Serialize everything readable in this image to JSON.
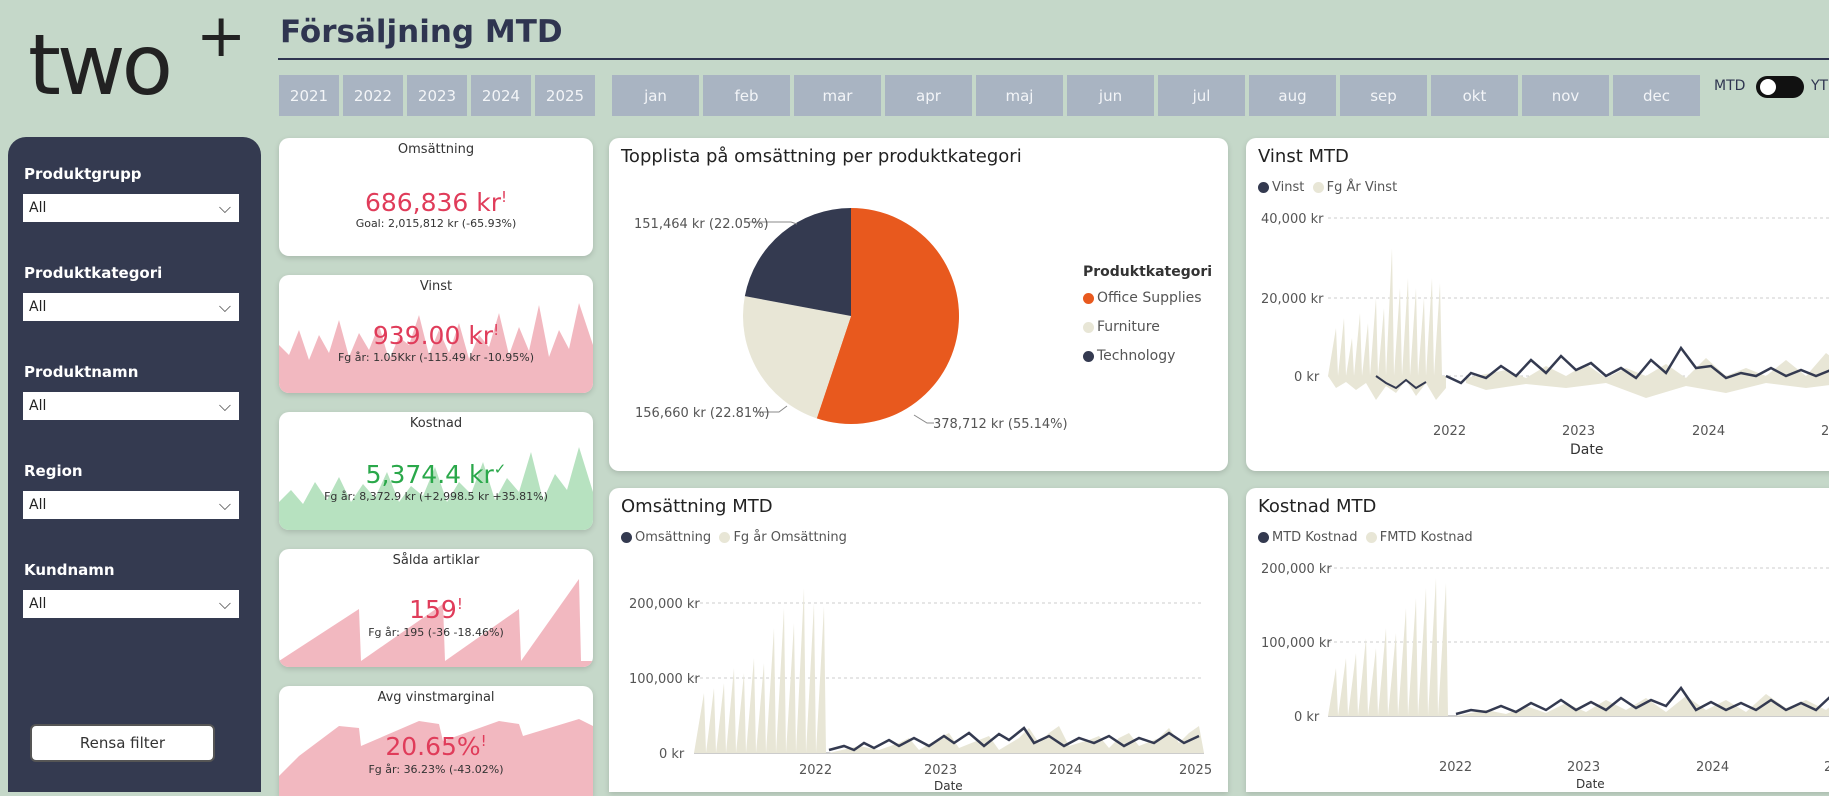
{
  "brand": {
    "logo_text": "two",
    "logo_plus": "+"
  },
  "page_title": "Försäljning MTD",
  "years": [
    "2021",
    "2022",
    "2023",
    "2024",
    "2025"
  ],
  "months": [
    "jan",
    "feb",
    "mar",
    "apr",
    "maj",
    "jun",
    "jul",
    "aug",
    "sep",
    "okt",
    "nov",
    "dec"
  ],
  "toggle": {
    "left": "MTD",
    "right": "YT"
  },
  "filters": [
    {
      "label": "Produktgrupp",
      "value": "All"
    },
    {
      "label": "Produktkategori",
      "value": "All"
    },
    {
      "label": "Produktnamn",
      "value": "All"
    },
    {
      "label": "Region",
      "value": "All"
    },
    {
      "label": "Kundnamn",
      "value": "All"
    }
  ],
  "clear_filter": "Rensa filter",
  "kpis": [
    {
      "title": "Omsättning",
      "value": "686,836 kr",
      "mark": "!",
      "sub": "Goal: 2,015,812 kr (-65.93%)"
    },
    {
      "title": "Vinst",
      "value": "939.00 kr",
      "mark": "!",
      "sub": "Fg år: 1.05Kkr (-115.49 kr -10.95%)"
    },
    {
      "title": "Kostnad",
      "value": "5,374.4 kr",
      "mark": "✓",
      "sub": "Fg år: 8,372.9 kr (+2,998.5 kr +35.81%)"
    },
    {
      "title": "Sålda artiklar",
      "value": "159",
      "mark": "!",
      "sub": "Fg år: 195 (-36 -18.46%)"
    },
    {
      "title": "Avg vinstmarginal",
      "value": "20.65%",
      "mark": "!",
      "sub": "Fg år: 36.23% (-43.02%)"
    }
  ],
  "colors": {
    "bg": "#c5d8c9",
    "navy": "#343a50",
    "orange": "#e8591e",
    "beige": "#e8e6d6",
    "red": "#e03c5a",
    "green": "#2aa84a",
    "pink": "#f2b8c0",
    "lightgreen": "#b7e2c0"
  },
  "pie": {
    "title": "Topplista på omsättning per produktkategori",
    "legend_title": "Produktkategori",
    "chart_data": {
      "type": "pie",
      "slices": [
        {
          "name": "Office Supplies",
          "value": 378712,
          "label": "378,712 kr (55.14%)",
          "color": "#e8591e"
        },
        {
          "name": "Furniture",
          "value": 156660,
          "label": "156,660 kr (22.81%)",
          "color": "#e8e6d6"
        },
        {
          "name": "Technology",
          "value": 151464,
          "label": "151,464 kr (22.05%)",
          "color": "#343a50"
        }
      ]
    }
  },
  "vinst_chart": {
    "title": "Vinst MTD",
    "legend": [
      "Vinst",
      "Fg År Vinst"
    ],
    "yticks": [
      "40,000 kr",
      "20,000 kr",
      "0 kr"
    ],
    "xticks": [
      "2022",
      "2023",
      "2024",
      "2"
    ],
    "xlabel": "Date"
  },
  "oms_chart": {
    "title": "Omsättning MTD",
    "legend": [
      "Omsättning",
      "Fg år Omsättning"
    ],
    "yticks": [
      "200,000 kr",
      "100,000 kr",
      "0 kr"
    ],
    "xticks": [
      "2022",
      "2023",
      "2024",
      "2025"
    ],
    "xlabel": "Date"
  },
  "kostnad_chart": {
    "title": "Kostnad MTD",
    "legend": [
      "MTD Kostnad",
      "FMTD Kostnad"
    ],
    "yticks": [
      "200,000 kr",
      "100,000 kr",
      "0 kr"
    ],
    "xticks": [
      "2022",
      "2023",
      "2024",
      "2"
    ],
    "xlabel": "Date"
  }
}
